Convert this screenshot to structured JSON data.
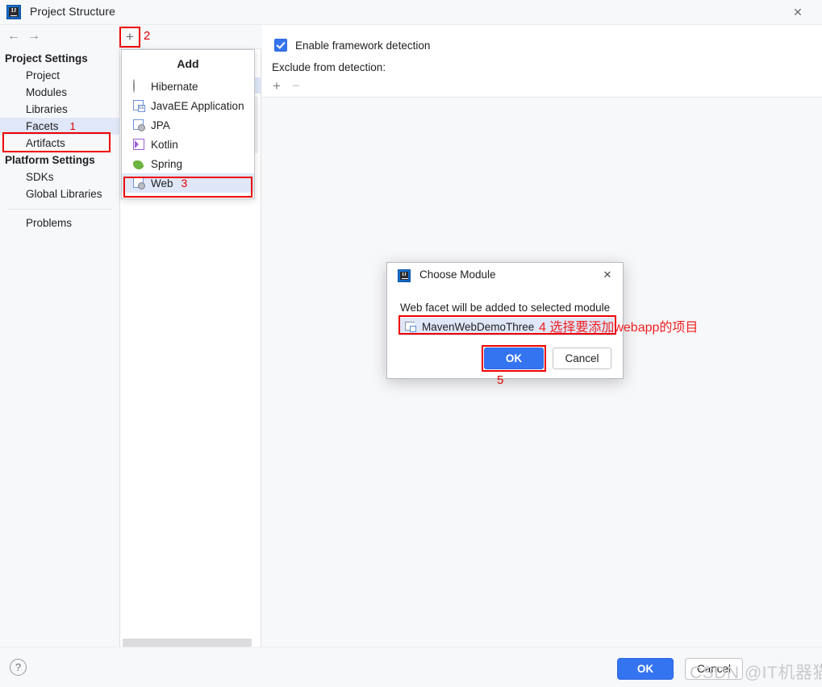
{
  "window": {
    "title": "Project Structure",
    "icon": "intellij-logo-icon",
    "close_label": "✕",
    "back_label": "←",
    "forward_label": "→"
  },
  "sidebar": {
    "groups": [
      {
        "label": "Project Settings",
        "items": [
          {
            "label": "Project",
            "selected": false,
            "marker": ""
          },
          {
            "label": "Modules",
            "selected": false,
            "marker": ""
          },
          {
            "label": "Libraries",
            "selected": false,
            "marker": ""
          },
          {
            "label": "Facets",
            "selected": true,
            "marker": "1"
          },
          {
            "label": "Artifacts",
            "selected": false,
            "marker": ""
          }
        ]
      },
      {
        "label": "Platform Settings",
        "items": [
          {
            "label": "SDKs",
            "selected": false,
            "marker": ""
          },
          {
            "label": "Global Libraries",
            "selected": false,
            "marker": ""
          }
        ]
      }
    ],
    "problems_label": "Problems"
  },
  "facets_toolbar": {
    "add_button_label": "+",
    "add_button_marker": "2"
  },
  "add_popup": {
    "title": "Add",
    "items": [
      {
        "label": "Hibernate",
        "icon": "hibernate-icon",
        "selected": false,
        "marker": ""
      },
      {
        "label": "JavaEE Application",
        "icon": "javaee-icon",
        "selected": false,
        "marker": ""
      },
      {
        "label": "JPA",
        "icon": "jpa-icon",
        "selected": false,
        "marker": ""
      },
      {
        "label": "Kotlin",
        "icon": "kotlin-icon",
        "selected": false,
        "marker": ""
      },
      {
        "label": "Spring",
        "icon": "spring-icon",
        "selected": false,
        "marker": ""
      },
      {
        "label": "Web",
        "icon": "web-icon",
        "selected": true,
        "marker": "3"
      }
    ]
  },
  "detail_panel": {
    "enable_detection_label": "Enable framework detection",
    "enable_detection_checked": true,
    "exclude_label": "Exclude from detection:",
    "add_exclude_label": "+",
    "remove_exclude_label": "−"
  },
  "choose_module_dialog": {
    "title": "Choose Module",
    "icon": "intellij-logo-icon",
    "close_label": "✕",
    "message": "Web facet will be added to selected module",
    "module": {
      "name": "MavenWebDemoThree",
      "icon": "module-icon",
      "selected": true,
      "marker": "4"
    },
    "ok_label": "OK",
    "cancel_label": "Cancel",
    "ok_marker": "5"
  },
  "annotations": {
    "step4_text": "4 选择要添加webapp的项目",
    "accent_red": "#ee0000",
    "accent_blue": "#3574f0"
  },
  "footer": {
    "help_label": "?",
    "ok_label": "OK",
    "cancel_label": "Cancel",
    "watermark": "CSDN @IT机器猫"
  }
}
